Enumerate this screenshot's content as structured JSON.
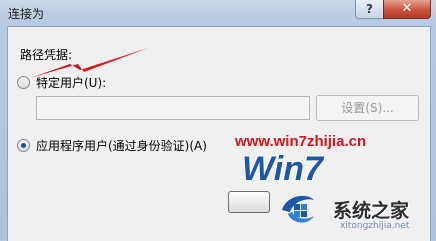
{
  "window": {
    "title": "连接为",
    "help_label": "?",
    "close_label": "✕"
  },
  "dialog": {
    "section_label": "路径凭据:",
    "option_specific_user": {
      "label": "特定用户(U):",
      "checked": false
    },
    "path_input": {
      "value": "",
      "placeholder": ""
    },
    "settings_button": {
      "label": "设置(S)...",
      "enabled": false
    },
    "option_app_user": {
      "label": "应用程序用户(通过身份验证)(A)",
      "checked": true
    }
  },
  "watermark": {
    "url": "www.win7zhijia.cn",
    "win7_text": "Win7",
    "site_name": "系统之家",
    "site_domain": "xitongzhijia.net"
  },
  "colors": {
    "annotation_arrow": "#d9131b",
    "accent": "#1d4f9c"
  }
}
